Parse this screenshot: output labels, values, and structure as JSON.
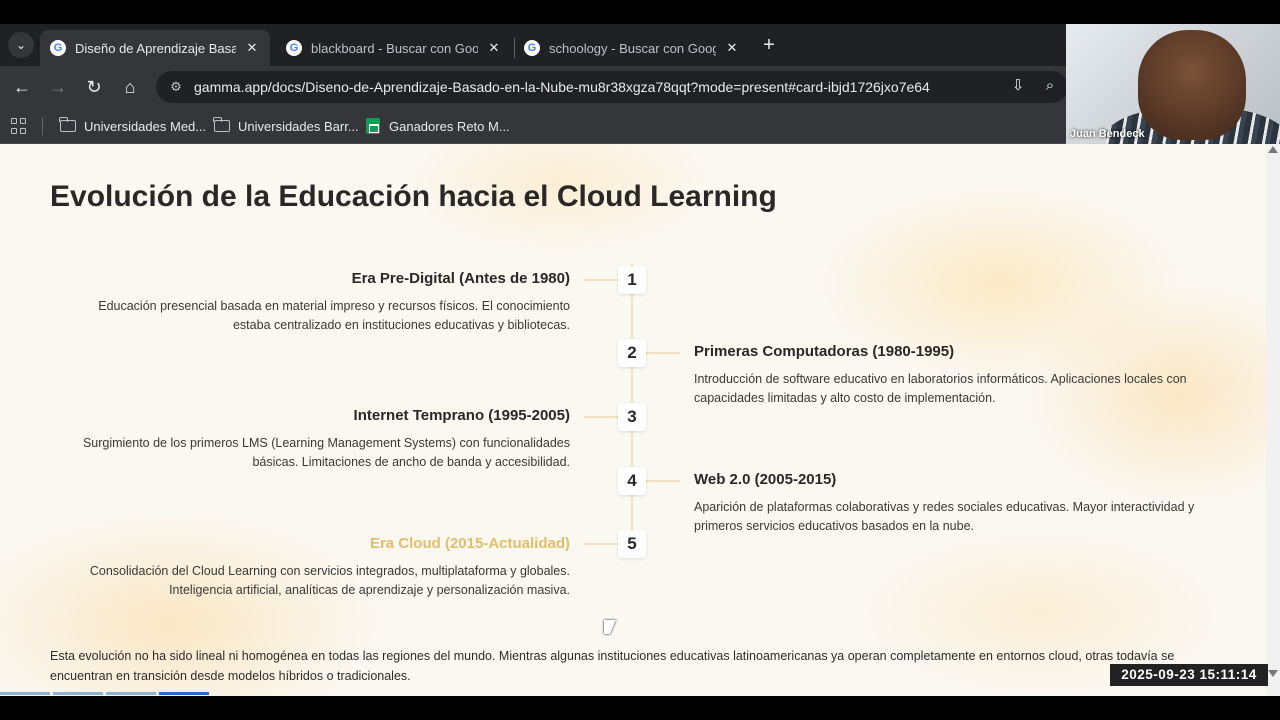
{
  "browser": {
    "tabs": [
      {
        "title": "Diseño de Aprendizaje Basado",
        "active": true
      },
      {
        "title": "blackboard - Buscar con Google",
        "active": false
      },
      {
        "title": "schoology - Buscar con Google",
        "active": false
      }
    ],
    "url": "gamma.app/docs/Diseno-de-Aprendizaje-Basado-en-la-Nube-mu8r38xgza78qqt?mode=present#card-ibjd1726jxo7e64",
    "bookmarks": [
      {
        "label": "Universidades Med...",
        "icon": "folder-icon"
      },
      {
        "label": "Universidades Barr...",
        "icon": "folder-icon"
      },
      {
        "label": "Ganadores Reto M...",
        "icon": "sheets-icon"
      }
    ]
  },
  "webcam": {
    "name": "Juan Bendeck"
  },
  "slide": {
    "title": "Evolución de la Educación hacia el Cloud Learning",
    "events": [
      {
        "number": "1",
        "title": "Era Pre-Digital (Antes de 1980)",
        "description": "Educación presencial basada en material impreso y recursos físicos. El conocimiento estaba centralizado en instituciones educativas y bibliotecas."
      },
      {
        "number": "2",
        "title": "Primeras Computadoras (1980-1995)",
        "description": "Introducción de software educativo en laboratorios informáticos. Aplicaciones locales con capacidades limitadas y alto costo de implementación."
      },
      {
        "number": "3",
        "title": "Internet Temprano (1995-2005)",
        "description": "Surgimiento de los primeros LMS (Learning Management Systems) con funcionalidades básicas. Limitaciones de ancho de banda y accesibilidad."
      },
      {
        "number": "4",
        "title": "Web 2.0 (2005-2015)",
        "description": "Aparición de plataformas colaborativas y redes sociales educativas. Mayor interactividad y primeros servicios educativos basados en la nube."
      },
      {
        "number": "5",
        "title": "Era Cloud (2015-Actualidad)",
        "description": "Consolidación del Cloud Learning con servicios integrados, multiplataforma y globales. Inteligencia artificial, analíticas de aprendizaje y personalización masiva."
      }
    ],
    "footnote": "Esta evolución no ha sido lineal ni homogénea en todas las regiones del mundo. Mientras algunas instituciones educativas latinoamericanas ya operan completamente en entornos cloud, otras todavía se encuentran en transición desde modelos híbridos o tradicionales."
  },
  "overlay": {
    "timestamp": "2025-09-23  15:11:14"
  },
  "progress": {
    "current": 4,
    "total": 4
  },
  "colors": {
    "highlight": "#e4bd68",
    "chrome_dark": "#202124",
    "chrome_toolbar": "#35363a"
  }
}
